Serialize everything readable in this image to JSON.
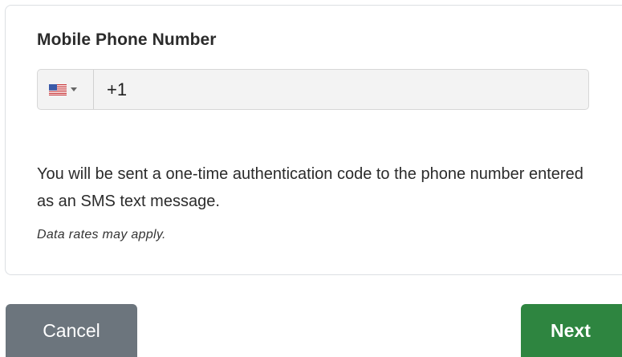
{
  "form": {
    "phone_label": "Mobile Phone Number",
    "country": {
      "selected_flag": "us-flag-icon"
    },
    "phone_value": "+1",
    "message": "You will be sent a one-time authentication code to the phone number entered as an SMS text message.",
    "note": "Data rates may apply."
  },
  "actions": {
    "cancel_label": "Cancel",
    "next_label": "Next"
  },
  "colors": {
    "cancel_bg": "#6c757d",
    "next_bg": "#2e8540",
    "card_border": "#dcdfe3",
    "input_bg": "#f3f3f3"
  }
}
